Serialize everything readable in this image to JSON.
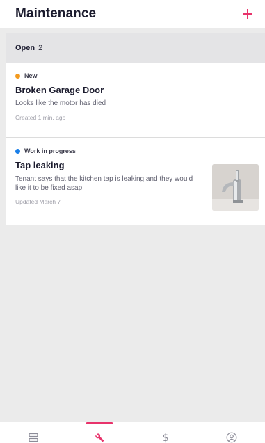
{
  "header": {
    "title": "Maintenance",
    "add_icon": "plus-icon",
    "accent_color": "#e8336b"
  },
  "section": {
    "label": "Open",
    "count": "2"
  },
  "requests": [
    {
      "status": "New",
      "status_color": "#f39a1f",
      "title": "Broken Garage Door",
      "description": "Looks like the motor has died",
      "meta": "Created 1 min. ago"
    },
    {
      "status": "Work in progress",
      "status_color": "#1a7fe8",
      "title": "Tap leaking",
      "description": "Tenant says that the kitchen tap is leaking and they would like it to be fixed asap.",
      "meta": "Updated March 7",
      "thumbnail": "kitchen-tap-photo"
    }
  ],
  "bottom_nav": {
    "items": [
      {
        "icon": "properties-icon",
        "active": false
      },
      {
        "icon": "wrench-icon",
        "active": true
      },
      {
        "icon": "dollar-icon",
        "label": "$",
        "active": false
      },
      {
        "icon": "profile-icon",
        "active": false
      }
    ]
  }
}
